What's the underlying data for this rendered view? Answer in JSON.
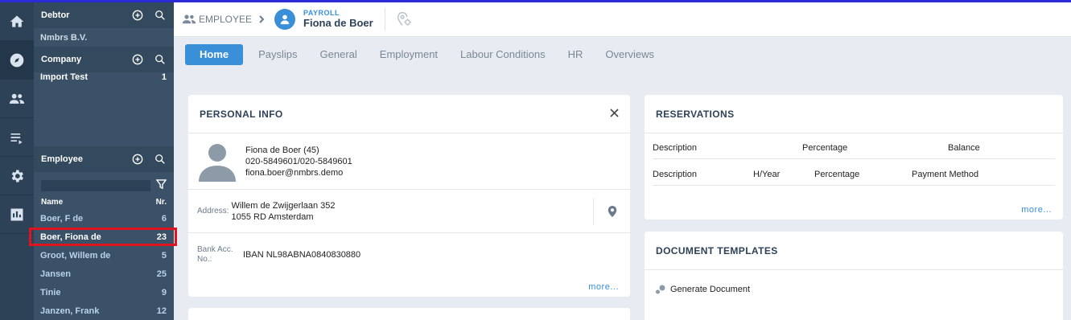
{
  "rail": {
    "items": [
      "home-icon",
      "compass-icon",
      "users-icon",
      "list-icon",
      "gear-icon",
      "chart-icon"
    ]
  },
  "sidebar": {
    "debtor": {
      "title": "Debtor",
      "value": "Nmbrs B.V."
    },
    "company": {
      "title": "Company",
      "items": [
        {
          "name": "Import Test",
          "count": "1"
        }
      ]
    },
    "employee": {
      "title": "Employee",
      "filter_placeholder": "",
      "col_name": "Name",
      "col_nr": "Nr.",
      "rows": [
        {
          "name": "Boer, F de",
          "nr": "6"
        },
        {
          "name": "Boer, Fiona de",
          "nr": "23"
        },
        {
          "name": "Groot, Willem de",
          "nr": "5"
        },
        {
          "name": "Jansen",
          "nr": "25"
        },
        {
          "name": "Tinie",
          "nr": "9"
        },
        {
          "name": "Janzen, Frank",
          "nr": "12"
        }
      ]
    }
  },
  "header": {
    "crumb_label": "EMPLOYEE",
    "section": "PAYROLL",
    "name": "Fiona de Boer"
  },
  "tabs": [
    "Home",
    "Payslips",
    "General",
    "Employment",
    "Labour Conditions",
    "HR",
    "Overviews"
  ],
  "personal_info": {
    "title": "PERSONAL INFO",
    "name_age": "Fiona de Boer (45)",
    "phone": "020-5849601/020-5849601",
    "email": "fiona.boer@nmbrs.demo",
    "address_label": "Address:",
    "address_line1": "Willem de Zwijgerlaan 352",
    "address_line2": "1055 RD Amsterdam",
    "bank_label": "Bank Acc. No.:",
    "bank_value": "IBAN NL98ABNA0840830880",
    "more": "more..."
  },
  "reservations": {
    "title": "RESERVATIONS",
    "table1_headers": [
      "Description",
      "Percentage",
      "Balance"
    ],
    "table2_headers": [
      "Description",
      "H/Year",
      "Percentage",
      "Payment Method"
    ],
    "more": "more..."
  },
  "document_templates": {
    "title": "DOCUMENT TEMPLATES",
    "action": "Generate Document"
  }
}
